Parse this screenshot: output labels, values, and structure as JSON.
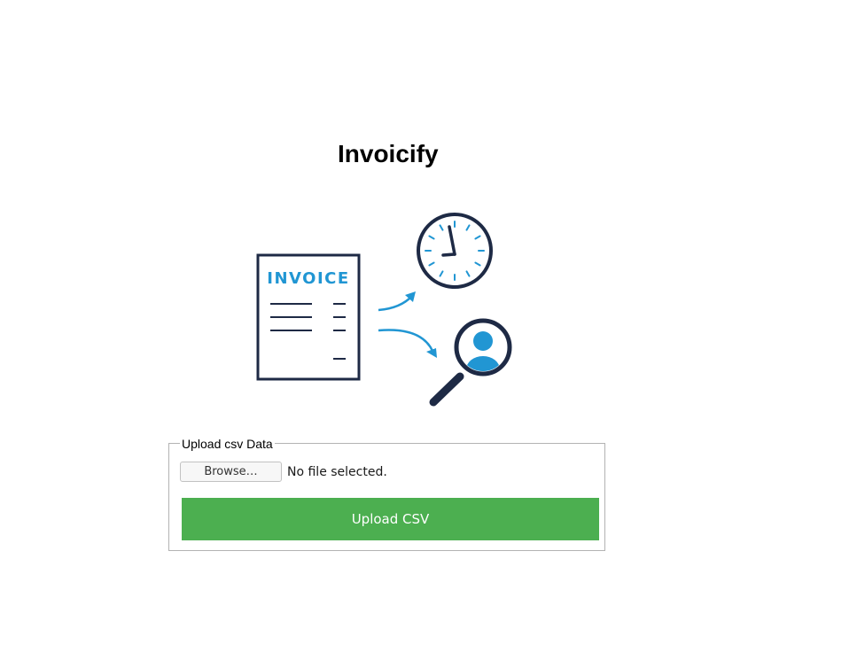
{
  "app": {
    "title": "Invoicify"
  },
  "hero": {
    "invoice_label": "INVOICE",
    "icons": [
      "invoice-document-icon",
      "clock-icon",
      "magnifier-user-icon",
      "arrow-icon"
    ],
    "colors": {
      "navy": "#1e2a45",
      "blue": "#2196d3"
    }
  },
  "upload": {
    "legend": "Upload csv Data",
    "browse_label": "Browse…",
    "file_status": "No file selected.",
    "submit_label": "Upload CSV",
    "submit_color": "#4caf50"
  }
}
